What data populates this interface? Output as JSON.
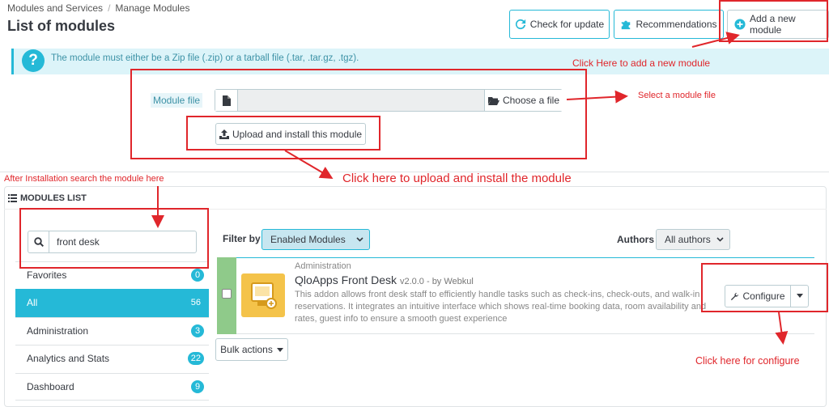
{
  "breadcrumb": {
    "parent": "Modules and Services",
    "separator": "/",
    "current": "Manage Modules"
  },
  "page_title": "List of modules",
  "toolbar": {
    "check_update": "Check for update",
    "recommendations": "Recommendations",
    "add_module": "Add a new module"
  },
  "alert": {
    "icon": "?",
    "text": "The module must either be a Zip file (.zip) or a tarball file (.tar, .tar.gz, .tgz)."
  },
  "upload": {
    "file_label": "Module file",
    "choose_label": "Choose a file",
    "install_label": "Upload and install this module"
  },
  "modules_list": {
    "heading": "MODULES LIST",
    "search_value": "front desk",
    "categories": [
      {
        "label": "Favorites",
        "count": "0"
      },
      {
        "label": "All",
        "count": "56"
      },
      {
        "label": "Administration",
        "count": "3"
      },
      {
        "label": "Analytics and Stats",
        "count": "22"
      },
      {
        "label": "Dashboard",
        "count": "9"
      }
    ],
    "filter_label": "Filter by",
    "filter_value": "Enabled Modules",
    "authors_label": "Authors",
    "authors_value": "All authors",
    "bulk_actions": "Bulk actions"
  },
  "module": {
    "category": "Administration",
    "name": "QloApps Front Desk",
    "version": "v2.0.0 - by Webkul",
    "description": "This addon allows front desk staff to efficiently handle tasks such as check-ins, check-outs, and walk-in reservations. It integrates an intuitive interface which shows real-time booking data, room availability and rates, guest info to ensure a smooth guest experience",
    "configure": "Configure"
  },
  "annotations": {
    "add_module": "Click Here to add a new module",
    "select_file": "Select a module file",
    "upload_install": "Click here to upload and install the module",
    "search_here": "After Installation search the module here",
    "configure": "Click here for configure"
  },
  "colors": {
    "accent": "#25b9d7",
    "annotation": "#e0262b",
    "enabled_strip": "#8fca8a"
  }
}
